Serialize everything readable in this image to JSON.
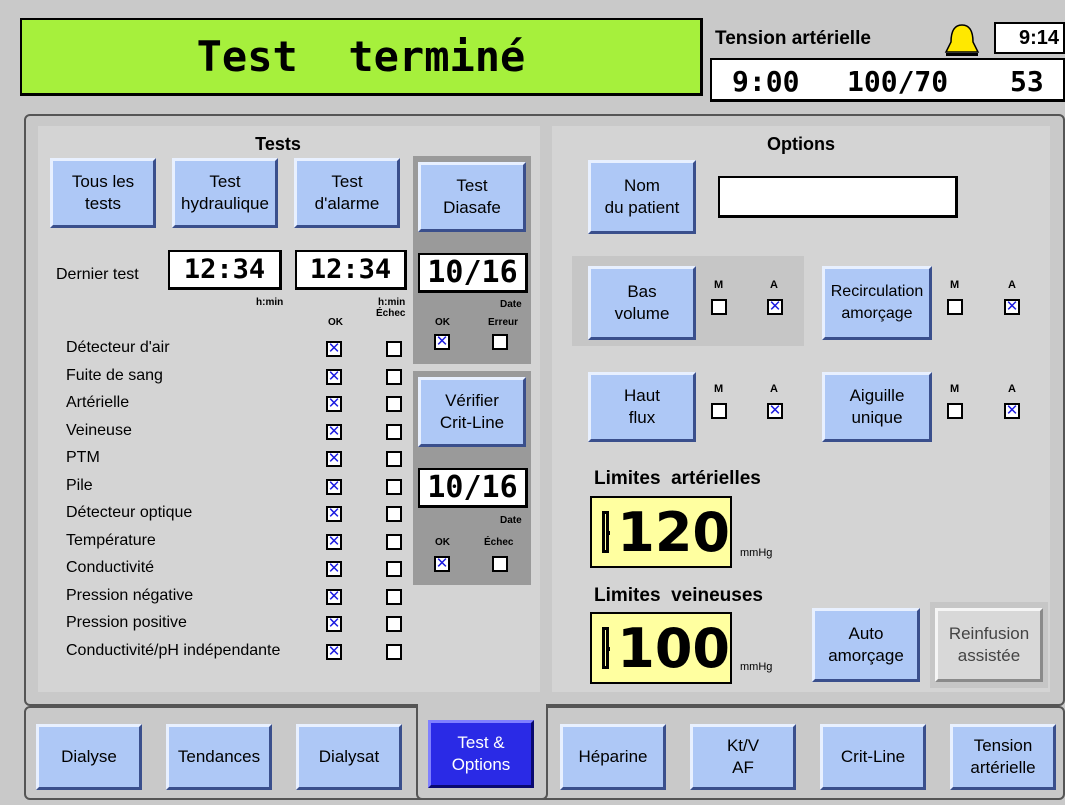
{
  "header": {
    "status_title": "Test  terminé",
    "bp_title": "Tension artérielle",
    "clock": "9:14",
    "bp_time": "9:00",
    "bp_value": "100/70",
    "bp_pulse": "53"
  },
  "tests": {
    "heading": "Tests",
    "buttons": {
      "all": "Tous les\ntests",
      "hydraulic": "Test\nhydraulique",
      "alarm": "Test\nd'alarme",
      "diasafe": "Test\nDiasafe",
      "crit_line": "Vérifier\nCrit-Line"
    },
    "last_test_label": "Dernier test",
    "last_times": [
      "12:34",
      "12:34"
    ],
    "diasafe_date": "10/16",
    "critline_date": "10/16",
    "hmin": "h:min",
    "date": "Date",
    "ok": "OK",
    "echec": "Échec",
    "erreur": "Erreur",
    "items": [
      {
        "label": "Détecteur d'air",
        "ok": true,
        "fail": false
      },
      {
        "label": "Fuite de sang",
        "ok": true,
        "fail": false
      },
      {
        "label": "Artérielle",
        "ok": true,
        "fail": false
      },
      {
        "label": "Veineuse",
        "ok": true,
        "fail": false
      },
      {
        "label": "PTM",
        "ok": true,
        "fail": false
      },
      {
        "label": "Pile",
        "ok": true,
        "fail": false
      },
      {
        "label": "Détecteur optique",
        "ok": true,
        "fail": false
      },
      {
        "label": "Température",
        "ok": true,
        "fail": false
      },
      {
        "label": "Conductivité",
        "ok": true,
        "fail": false
      },
      {
        "label": "Pression négative",
        "ok": true,
        "fail": false
      },
      {
        "label": "Pression positive",
        "ok": true,
        "fail": false
      },
      {
        "label": "Conductivité/pH indépendante",
        "ok": true,
        "fail": false
      }
    ],
    "diasafe_ok": true,
    "diasafe_error": false,
    "critline_ok": true,
    "critline_fail": false
  },
  "options": {
    "heading": "Options",
    "patient_name_button": "Nom\ndu patient",
    "patient_name_value": "",
    "m": "M",
    "a": "A",
    "bas_volume": "Bas\nvolume",
    "recirculation": "Recirculation\namorçage",
    "haut_flux": "Haut\nflux",
    "aiguille": "Aiguille\nunique",
    "flags": {
      "bas_volume": {
        "m": false,
        "a": true
      },
      "recirculation": {
        "m": false,
        "a": true
      },
      "haut_flux": {
        "m": false,
        "a": true
      },
      "aiguille": {
        "m": false,
        "a": true
      }
    },
    "arterial_title": "Limites  artérielles",
    "arterial_value": "120",
    "venous_title": "Limites  veineuses",
    "venous_value": "100",
    "unit": "mmHg",
    "auto_priming": "Auto\namorçage",
    "reinfusion": "Reinfusion\nassistée"
  },
  "bottom_tabs": [
    {
      "label": "Dialyse"
    },
    {
      "label": "Tendances"
    },
    {
      "label": "Dialysat"
    },
    {
      "label": "Test &\nOptions",
      "active": true
    },
    {
      "label": "Héparine"
    },
    {
      "label": "Kt/V\nAF"
    },
    {
      "label": "Crit-Line"
    },
    {
      "label": "Tension\nartérielle"
    }
  ],
  "colors": {
    "status_green": "#a6f03c",
    "button_blue": "#aec8f6",
    "active_tab": "#2a2ae6",
    "limit_yellow": "#ffffa0"
  }
}
